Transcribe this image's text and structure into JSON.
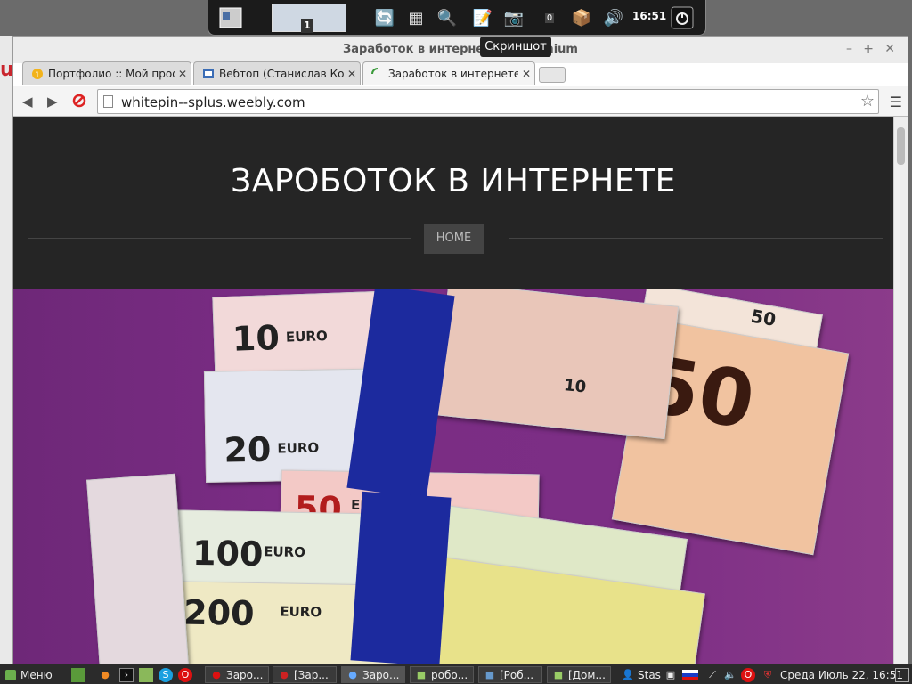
{
  "dock": {
    "workspace_count": "1",
    "battery_label": "0",
    "time": "16:51",
    "tooltip": "Скриншот"
  },
  "window": {
    "title": "Заработок в интернете - Chromium",
    "tabs": [
      {
        "label": "Портфолио :: Мой проф",
        "icon": "portfolio-icon"
      },
      {
        "label": "Вебтоп (Станислав Коб",
        "icon": "webtop-icon"
      },
      {
        "label": "Заработок в интернете",
        "icon": "loading-icon"
      }
    ],
    "url": "whitepin--splus.weebly.com"
  },
  "site": {
    "title": "ЗАРОБОТОК В ИНТЕРНЕТЕ",
    "nav_home": "HOME",
    "bills": [
      {
        "den": "10",
        "cur": "EURO"
      },
      {
        "den": "20",
        "cur": "EURO"
      },
      {
        "den": "50",
        "cur": "EURO"
      },
      {
        "den": "100",
        "cur": "EURO"
      },
      {
        "den": "200",
        "cur": "EURO"
      },
      {
        "den": "50",
        "cur": ""
      },
      {
        "den": "10",
        "cur": ""
      }
    ]
  },
  "taskbar": {
    "menu_label": "Меню",
    "items": [
      "Заро...",
      "[Зар...",
      "Заро...",
      "робо...",
      "[Роб...",
      "[Дом..."
    ],
    "user": "Stas",
    "datetime": "Среда Июль 22, 16:51"
  }
}
